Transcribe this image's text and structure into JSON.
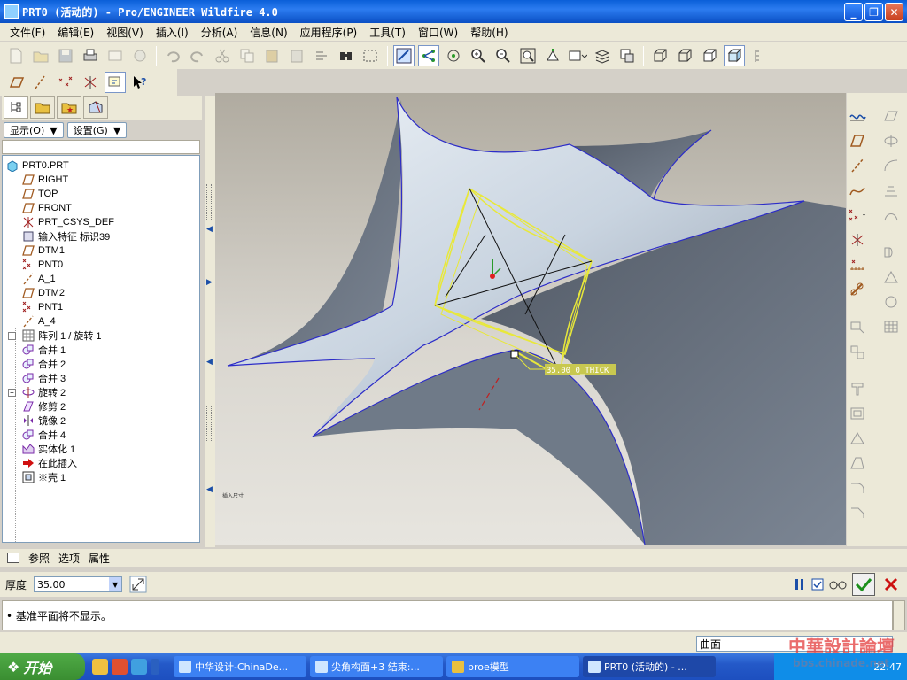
{
  "window": {
    "title": "PRT0 (活动的) - Pro/ENGINEER Wildfire 4.0"
  },
  "menubar": [
    "文件(F)",
    "编辑(E)",
    "视图(V)",
    "插入(I)",
    "分析(A)",
    "信息(N)",
    "应用程序(P)",
    "工具(T)",
    "窗口(W)",
    "帮助(H)"
  ],
  "navigator": {
    "show_label": "显示(O)",
    "settings_label": "设置(G)",
    "tree": [
      {
        "label": "PRT0.PRT",
        "icon": "part-icon",
        "indent": 0
      },
      {
        "label": "RIGHT",
        "icon": "datum-plane-icon",
        "indent": 1
      },
      {
        "label": "TOP",
        "icon": "datum-plane-icon",
        "indent": 1
      },
      {
        "label": "FRONT",
        "icon": "datum-plane-icon",
        "indent": 1
      },
      {
        "label": "PRT_CSYS_DEF",
        "icon": "csys-icon",
        "indent": 1
      },
      {
        "label": "输入特征 标识39",
        "icon": "import-feature-icon",
        "indent": 1
      },
      {
        "label": "DTM1",
        "icon": "datum-plane-icon",
        "indent": 1
      },
      {
        "label": "PNT0",
        "icon": "datum-point-icon",
        "indent": 1
      },
      {
        "label": "A_1",
        "icon": "datum-axis-icon",
        "indent": 1
      },
      {
        "label": "DTM2",
        "icon": "datum-plane-icon",
        "indent": 1
      },
      {
        "label": "PNT1",
        "icon": "datum-point-icon",
        "indent": 1
      },
      {
        "label": "A_4",
        "icon": "datum-axis-icon",
        "indent": 1
      },
      {
        "label": "阵列 1 / 旋转 1",
        "icon": "pattern-icon",
        "indent": 1,
        "expandable": true
      },
      {
        "label": "合并 1",
        "icon": "merge-icon",
        "indent": 1
      },
      {
        "label": "合并 2",
        "icon": "merge-icon",
        "indent": 1
      },
      {
        "label": "合并 3",
        "icon": "merge-icon",
        "indent": 1
      },
      {
        "label": "旋转 2",
        "icon": "revolve-icon",
        "indent": 1,
        "expandable": true
      },
      {
        "label": "修剪 2",
        "icon": "trim-icon",
        "indent": 1
      },
      {
        "label": "镜像 2",
        "icon": "mirror-icon",
        "indent": 1
      },
      {
        "label": "合并 4",
        "icon": "merge-icon",
        "indent": 1
      },
      {
        "label": "实体化 1",
        "icon": "solidify-icon",
        "indent": 1
      },
      {
        "label": "在此插入",
        "icon": "insert-here-arrow-icon",
        "indent": 1
      },
      {
        "label": "※壳 1",
        "icon": "shell-icon",
        "indent": 1
      }
    ]
  },
  "viewport": {
    "dim_label": "35.00 0_THICK",
    "corner_label": "插入尺寸"
  },
  "dashboard": {
    "tabs": [
      "参照",
      "选项",
      "属性"
    ],
    "thickness_label": "厚度",
    "thickness_value": "35.00"
  },
  "message": "• 基准平面将不显示。",
  "filter_value": "曲面",
  "taskbar": {
    "start_label": "开始",
    "items": [
      "中华设计-ChinaDe...",
      "尖角构面+3 结束:...",
      "proe模型",
      "PRT0 (活动的) - ..."
    ],
    "clock": "22:47"
  },
  "watermark": {
    "text": "中華設計論壇",
    "url": "bbs.chinade.net"
  },
  "colors": {
    "titlebar": "#0a5fd8",
    "surface_edge": "#2c2cc8",
    "preview_yellow": "#e8e83a",
    "ok_green": "#1b8f1b",
    "cancel_red": "#cc1010"
  }
}
